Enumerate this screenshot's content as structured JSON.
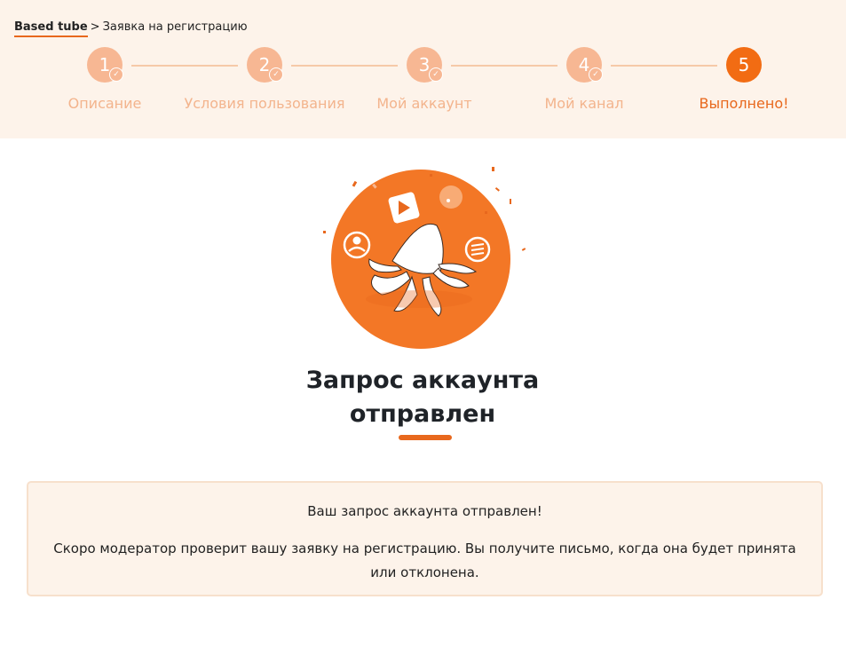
{
  "breadcrumb": {
    "home": "Based tube",
    "separator": ">",
    "current": "Заявка на регистрацию"
  },
  "steps": [
    {
      "number": "1",
      "label": "Описание",
      "status": "completed"
    },
    {
      "number": "2",
      "label": "Условия пользования",
      "status": "completed"
    },
    {
      "number": "3",
      "label": "Мой аккаунт",
      "status": "completed"
    },
    {
      "number": "4",
      "label": "Мой канал",
      "status": "completed"
    },
    {
      "number": "5",
      "label": "Выполнено!",
      "status": "current"
    }
  ],
  "main": {
    "title_line1": "Запрос аккаунта",
    "title_line2": "отправлен",
    "message": "Ваш запрос аккаунта отправлен!",
    "details": "Скоро модератор проверит вашу заявку на регистрацию. Вы получите письмо, когда она будет принята или отклонена."
  },
  "colors": {
    "accent": "#e8681d",
    "header_bg": "#fdf3ea",
    "step_inactive": "#f7b793",
    "step_active": "#f26c13"
  },
  "icons": {
    "completed_step": "check-icon",
    "illustration": "octopus-celebration-illustration"
  }
}
